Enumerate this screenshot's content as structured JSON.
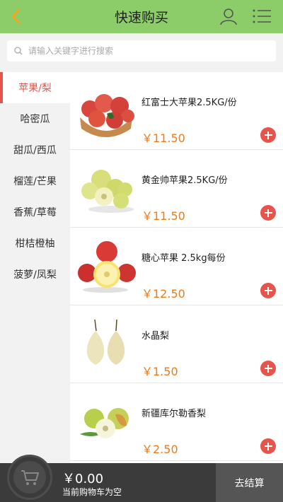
{
  "header": {
    "title": "快速购买",
    "back_icon": "chevron-left-icon",
    "user_icon": "user-icon",
    "menu_icon": "list-menu-icon"
  },
  "search": {
    "placeholder": "请输入关键字进行搜索",
    "value": ""
  },
  "categories": [
    {
      "label": "苹果/梨",
      "active": true
    },
    {
      "label": "哈密瓜"
    },
    {
      "label": "甜瓜/西瓜"
    },
    {
      "label": "榴莲/芒果"
    },
    {
      "label": "香蕉/草莓"
    },
    {
      "label": "柑桔橙柚"
    },
    {
      "label": "菠萝/凤梨"
    }
  ],
  "products": [
    {
      "name": "红富士大苹果2.5KG/份",
      "price": "￥11.50"
    },
    {
      "name": "黄金帅苹果2.5KG/份",
      "price": "￥11.50"
    },
    {
      "name": "糖心苹果 2.5kg每份",
      "price": "￥12.50"
    },
    {
      "name": "水晶梨",
      "price": "￥1.50"
    },
    {
      "name": "新疆库尔勒香梨",
      "price": "￥2.50"
    }
  ],
  "cart": {
    "total": "￥0.00",
    "status": "当前购物车为空",
    "checkout_label": "去结算"
  },
  "colors": {
    "header_bg": "#8ccd6a",
    "accent": "#e8534b",
    "price": "#ef7a16",
    "bottom_bg": "#3b3b3b"
  }
}
